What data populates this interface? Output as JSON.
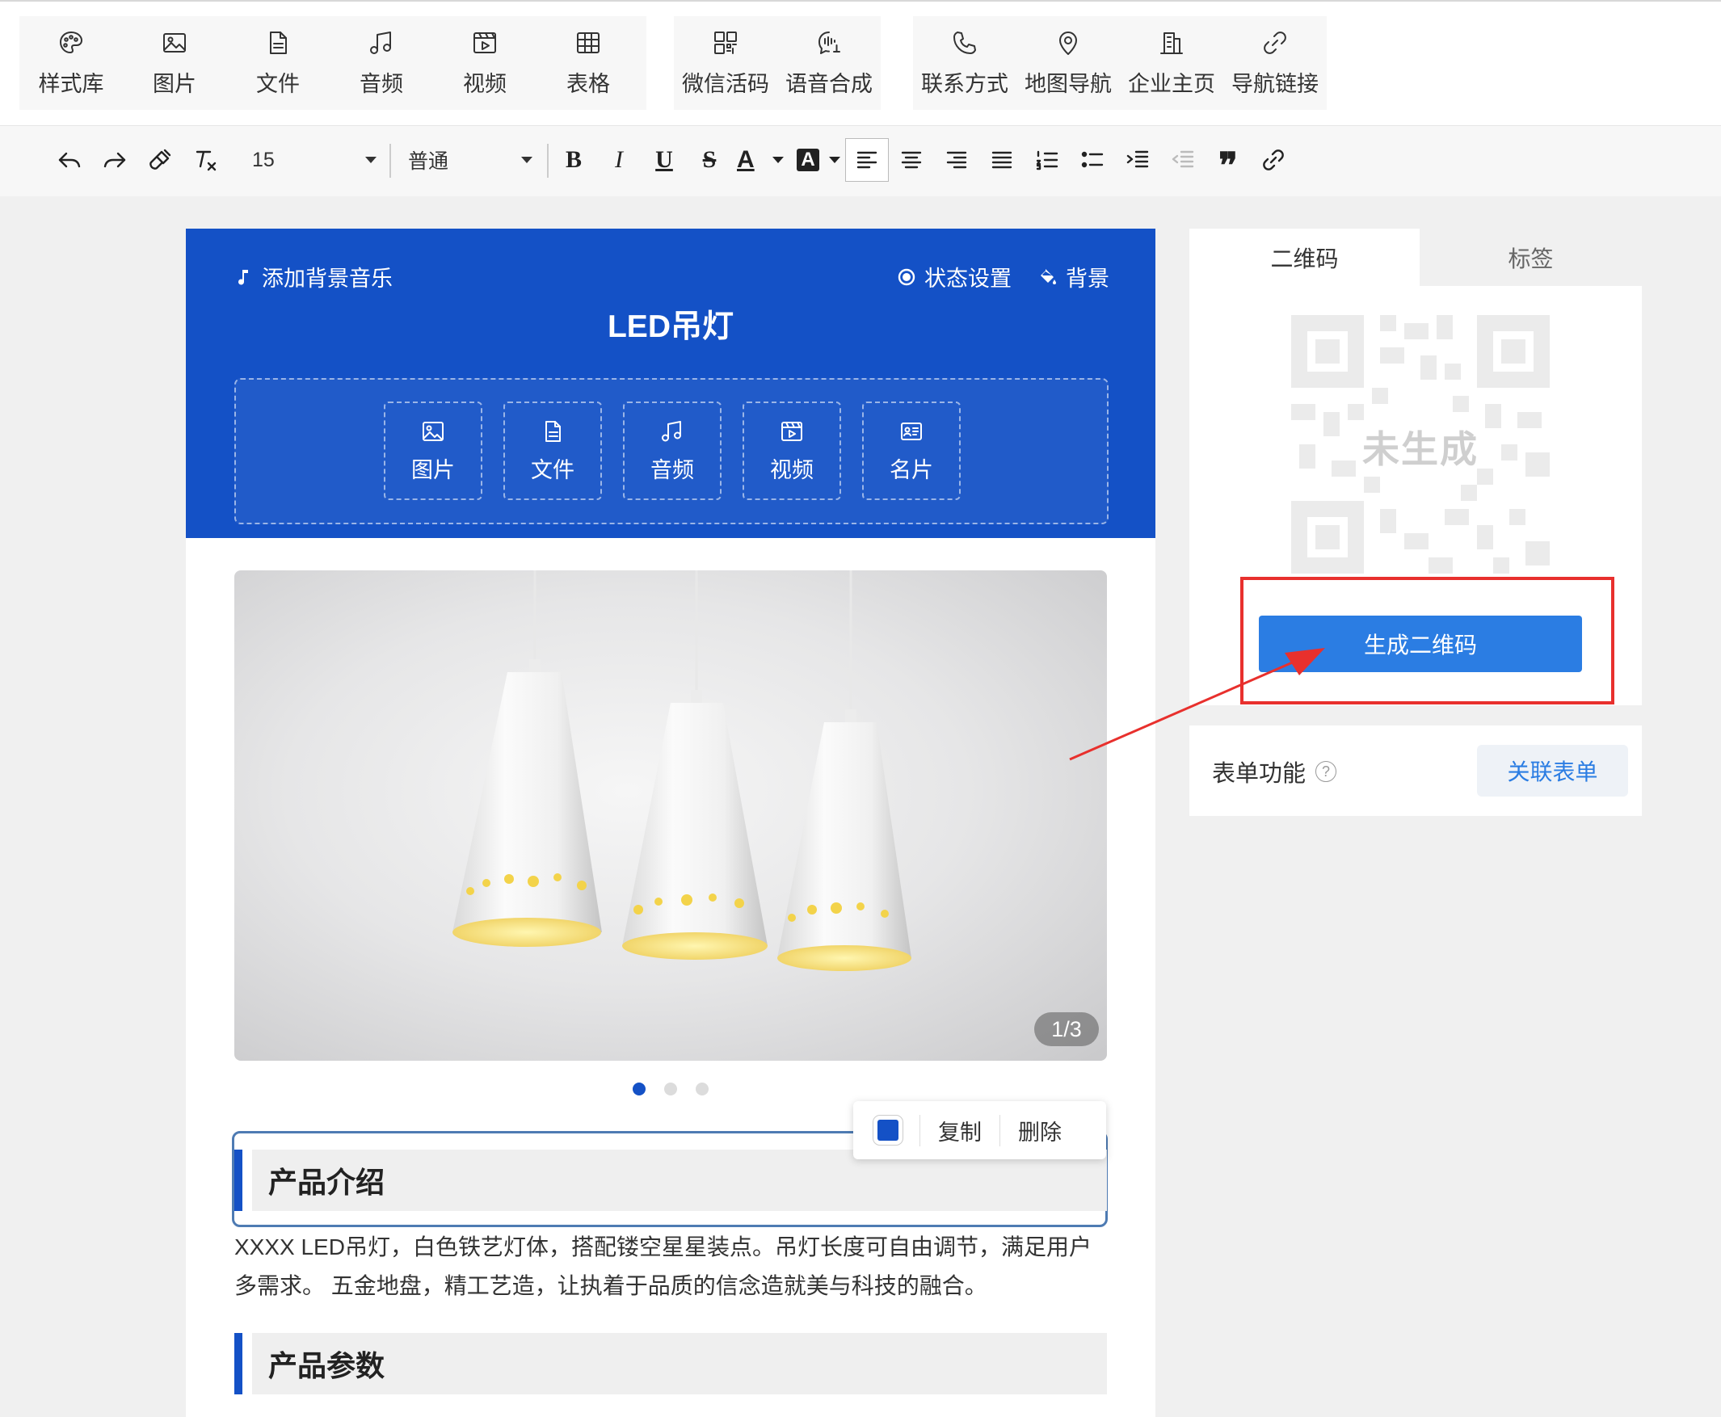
{
  "toolbar": {
    "groups": [
      [
        {
          "label": "样式库",
          "icon": "palette-icon"
        },
        {
          "label": "图片",
          "icon": "image-icon"
        },
        {
          "label": "文件",
          "icon": "file-icon"
        },
        {
          "label": "音频",
          "icon": "music-icon"
        },
        {
          "label": "视频",
          "icon": "video-icon"
        },
        {
          "label": "表格",
          "icon": "table-icon"
        }
      ],
      [
        {
          "label": "微信活码",
          "icon": "qrcode-icon"
        },
        {
          "label": "语音合成",
          "icon": "voice-icon"
        }
      ],
      [
        {
          "label": "联系方式",
          "icon": "phone-icon"
        },
        {
          "label": "地图导航",
          "icon": "location-icon"
        },
        {
          "label": "企业主页",
          "icon": "building-icon"
        },
        {
          "label": "导航链接",
          "icon": "link-icon"
        }
      ]
    ]
  },
  "format_bar": {
    "font_size": "15",
    "paragraph_style": "普通",
    "active_button": "align-left"
  },
  "editor": {
    "bg_music_label": "添加背景音乐",
    "status_label": "状态设置",
    "background_label": "背景",
    "title": "LED吊灯",
    "media_buttons": [
      {
        "label": "图片",
        "icon": "image-icon"
      },
      {
        "label": "文件",
        "icon": "file-icon"
      },
      {
        "label": "音频",
        "icon": "music-icon"
      },
      {
        "label": "视频",
        "icon": "video-icon"
      },
      {
        "label": "名片",
        "icon": "card-icon"
      }
    ],
    "carousel": {
      "counter": "1/3",
      "current": 1,
      "total": 3
    },
    "float_menu": {
      "copy": "复制",
      "delete": "删除"
    },
    "section1_title": "产品介绍",
    "section1_text": "XXXX LED吊灯，白色铁艺灯体，搭配镂空星星装点。吊灯长度可自由调节，满足用户多需求。 五金地盘，精工艺造，让执着于品质的信念造就美与科技的融合。",
    "section2_title": "产品参数"
  },
  "right_panel": {
    "tabs": [
      "二维码",
      "标签"
    ],
    "active_tab": "二维码",
    "qr_placeholder": "未生成",
    "generate_button": "生成二维码",
    "form_label": "表单功能",
    "form_help": "?",
    "link_form_button": "关联表单"
  },
  "colors": {
    "brand_blue": "#1451c6",
    "button_blue": "#2b7de3",
    "highlight_red": "#e8302d"
  }
}
